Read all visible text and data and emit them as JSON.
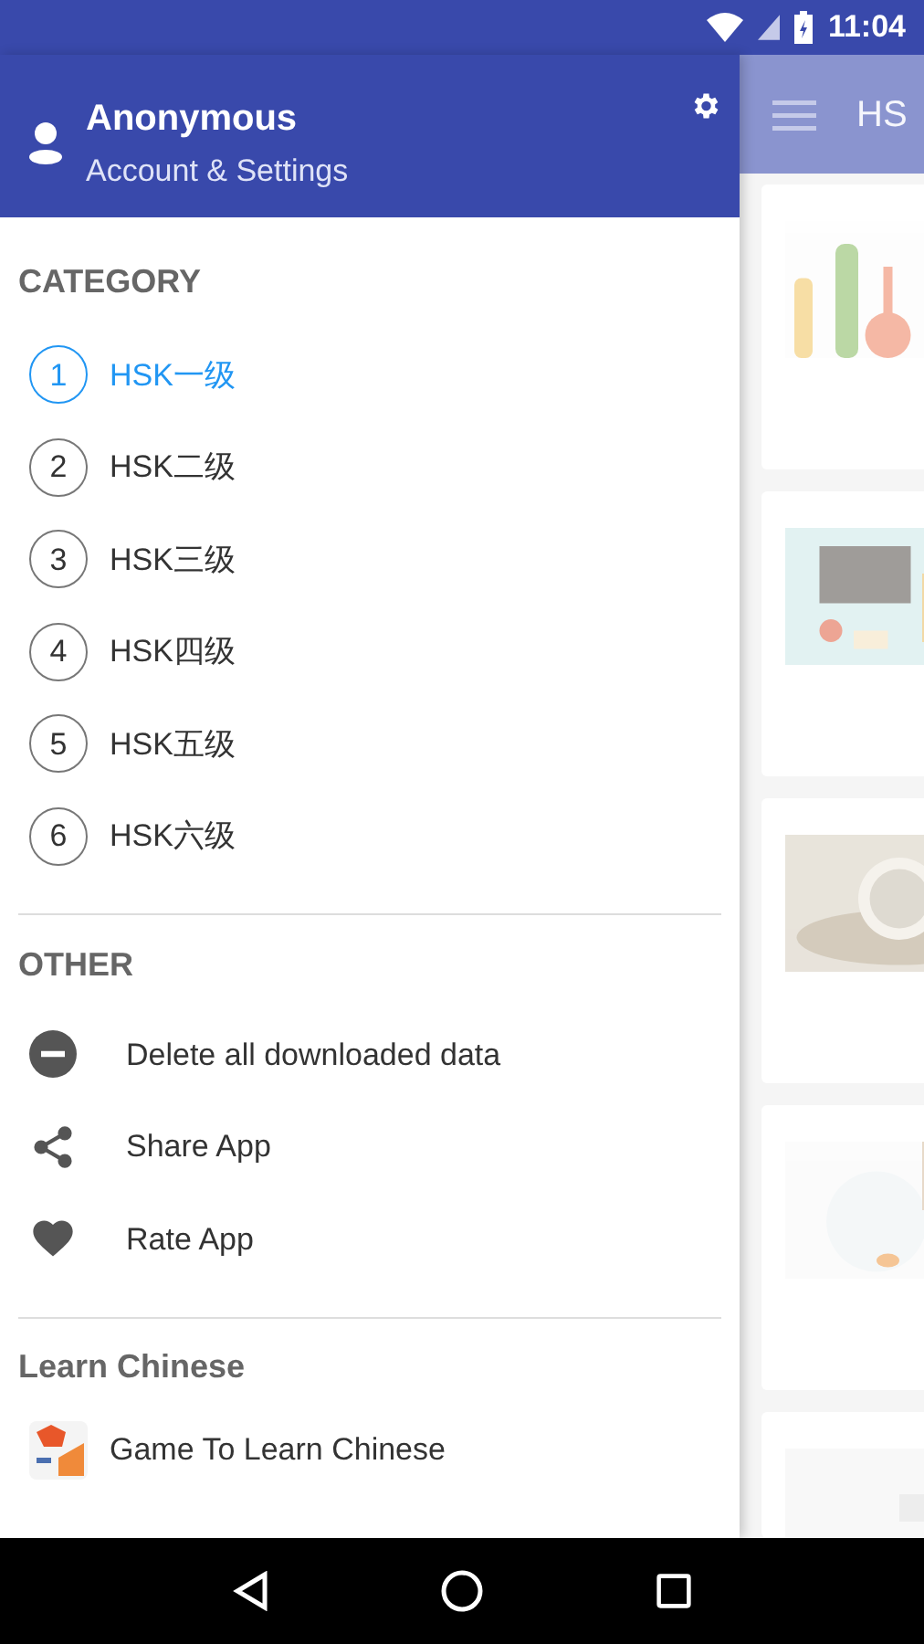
{
  "status_bar": {
    "time": "11:04"
  },
  "drawer": {
    "header": {
      "name": "Anonymous",
      "subtitle": "Account & Settings"
    },
    "category": {
      "title": "CATEGORY",
      "items": [
        {
          "number": "1",
          "label": "HSK一级",
          "selected": true
        },
        {
          "number": "2",
          "label": "HSK二级",
          "selected": false
        },
        {
          "number": "3",
          "label": "HSK三级",
          "selected": false
        },
        {
          "number": "4",
          "label": "HSK四级",
          "selected": false
        },
        {
          "number": "5",
          "label": "HSK五级",
          "selected": false
        },
        {
          "number": "6",
          "label": "HSK六级",
          "selected": false
        }
      ]
    },
    "other": {
      "title": "OTHER",
      "items": [
        {
          "kind": "delete",
          "label": "Delete all downloaded data"
        },
        {
          "kind": "share",
          "label": "Share App"
        },
        {
          "kind": "heart",
          "label": "Rate App"
        }
      ]
    },
    "learn": {
      "title": "Learn Chinese",
      "items": [
        {
          "label": "Game To Learn Chinese"
        }
      ]
    }
  },
  "main": {
    "toolbar": {
      "title": "HS"
    }
  }
}
